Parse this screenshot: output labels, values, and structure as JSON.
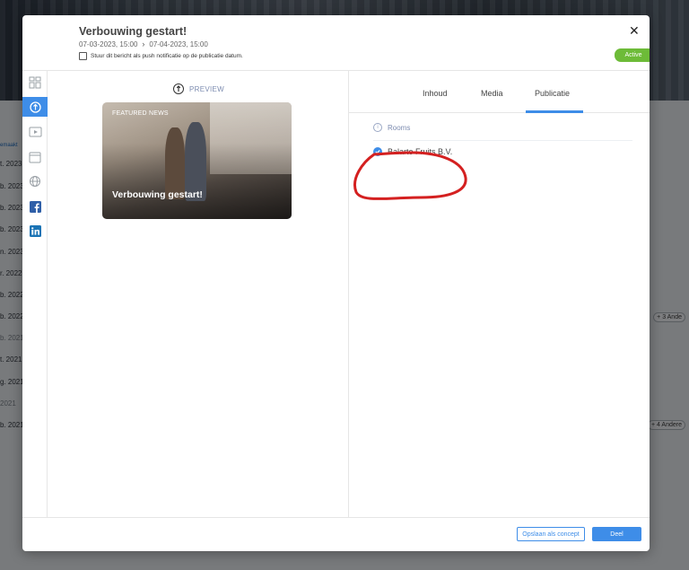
{
  "background": {
    "sidebar_link": "emaakt",
    "dates": [
      "t. 2023",
      "b. 2023",
      "b. 2023",
      "b. 2023",
      "n. 2023",
      "r. 2022",
      "b. 2022",
      "b. 2022",
      "b. 2021",
      "t. 2021",
      "g. 2021",
      "2021",
      "b. 2021"
    ],
    "chips": [
      "+ 3 Ande",
      "+ 4 Andere"
    ]
  },
  "modal": {
    "title": "Verbouwing gestart!",
    "start_date": "07-03-2023, 15:00",
    "end_date": "07-04-2023, 15:00",
    "push_label": "Stuur dit bericht als push notificatie op de publicatie datum.",
    "status": "Active",
    "close_glyph": "✕"
  },
  "preview": {
    "heading": "PREVIEW",
    "card_label": "FEATURED NEWS",
    "card_title": "Verbouwing gestart!"
  },
  "tabs": [
    {
      "label": "Inhoud"
    },
    {
      "label": "Media"
    },
    {
      "label": "Publicatie"
    }
  ],
  "publication": {
    "section_label": "Rooms",
    "rooms": [
      {
        "name": "Balarto Fruits B.V.",
        "checked": true
      }
    ]
  },
  "footer": {
    "concept_label": "Opslaan als concept",
    "share_label": "Deel"
  },
  "rail_icons": [
    "layout-icon",
    "preview-icon",
    "video-icon",
    "calendar-icon",
    "globe-icon",
    "facebook-icon",
    "linkedin-icon"
  ],
  "colors": {
    "accent": "#3e8de8",
    "active_badge": "#6dbb38",
    "annotation": "#d42020"
  }
}
